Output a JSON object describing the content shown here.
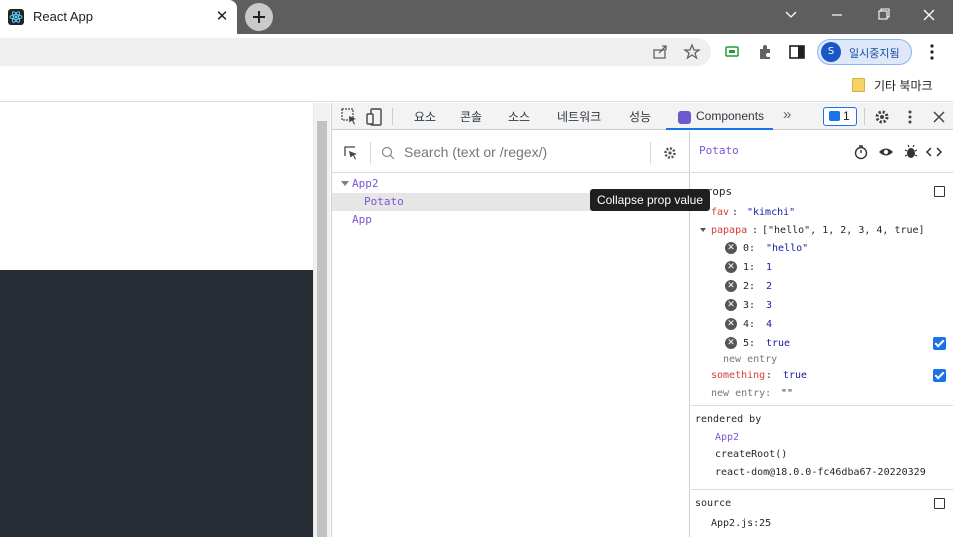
{
  "browser": {
    "tab_title": "React App",
    "close_label": "✕",
    "profile_initial": "S",
    "profile_label": "일시중지됨",
    "bookmark_folder": "기타 북마크"
  },
  "devtools": {
    "tabs": [
      "요소",
      "콘솔",
      "소스",
      "네트워크",
      "성능"
    ],
    "active_tab": "Components",
    "more_tabs": "»",
    "message_count": "1",
    "close_label": "✕"
  },
  "components": {
    "search_placeholder": "Search (text or /regex/)",
    "tree": [
      {
        "label": "App2",
        "expanded": true
      },
      {
        "label": "Potato",
        "selected": true
      },
      {
        "label": "App"
      }
    ],
    "tooltip": "Collapse prop value"
  },
  "inspector": {
    "title": "Potato",
    "props_label": "props",
    "fav_key": "fav",
    "fav_value": "\"kimchi\"",
    "papapa_key": "papapa",
    "papapa_summary": "[\"hello\", 1, 2, 3, 4, true]",
    "papapa_items": [
      {
        "index": "0:",
        "value": "\"hello\""
      },
      {
        "index": "1:",
        "value": "1"
      },
      {
        "index": "2:",
        "value": "2"
      },
      {
        "index": "3:",
        "value": "3"
      },
      {
        "index": "4:",
        "value": "4"
      },
      {
        "index": "5:",
        "value": "true"
      }
    ],
    "new_entry_inner": "new entry",
    "something_key": "something",
    "something_value": "true",
    "new_entry_outer": "new entry:",
    "new_entry_outer_value": "\"\"",
    "rendered_by_label": "rendered by",
    "rendered_by": [
      "App2",
      "createRoot()",
      "react-dom@18.0.0-fc46dba67-20220329"
    ],
    "source_label": "source",
    "source_value": "App2.js:25"
  },
  "colors": {
    "accent": "#1a73e8",
    "component_name": "#7a55d6",
    "prop_key": "#d63c3c",
    "app_bg": "#282c34"
  }
}
